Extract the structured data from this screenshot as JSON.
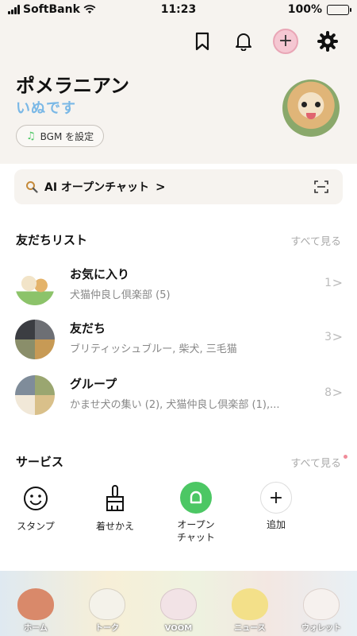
{
  "status_bar": {
    "carrier": "SoftBank",
    "time": "11:23",
    "battery": "100%"
  },
  "header": {
    "profile_name": "ポメラニアン",
    "profile_status": "いぬです",
    "bgm_label": "BGM を設定"
  },
  "search": {
    "label": "AI オープンチャット",
    "chevron": ">"
  },
  "friends_section": {
    "title": "友だちリスト",
    "more": "すべて見る",
    "rows": [
      {
        "name": "お気に入り",
        "desc": "犬猫仲良し倶楽部 (5)",
        "count": "1"
      },
      {
        "name": "友だち",
        "desc": "ブリティッシュブルー, 柴犬, 三毛猫",
        "count": "3"
      },
      {
        "name": "グループ",
        "desc": "かませ犬の集い (2), 犬猫仲良し倶楽部 (1),...",
        "count": "8"
      }
    ]
  },
  "services_section": {
    "title": "サービス",
    "more": "すべて見る",
    "items": [
      {
        "label": "スタンプ",
        "icon": "smile-icon"
      },
      {
        "label": "着せかえ",
        "icon": "brush-icon"
      },
      {
        "label": "オープン\nチャット",
        "label_line1": "オープン",
        "label_line2": "チャット",
        "icon": "open-chat-icon"
      },
      {
        "label": "追加",
        "icon": "plus-icon"
      }
    ]
  },
  "bottom_nav": {
    "tabs": [
      {
        "label": "ホーム"
      },
      {
        "label": "トーク"
      },
      {
        "label": "VOOM"
      },
      {
        "label": "ニュース"
      },
      {
        "label": "ウォレット"
      }
    ]
  },
  "colors": {
    "accent_green": "#4cc764",
    "header_bg": "#f6f3ef",
    "battery_green": "#4cd964"
  }
}
